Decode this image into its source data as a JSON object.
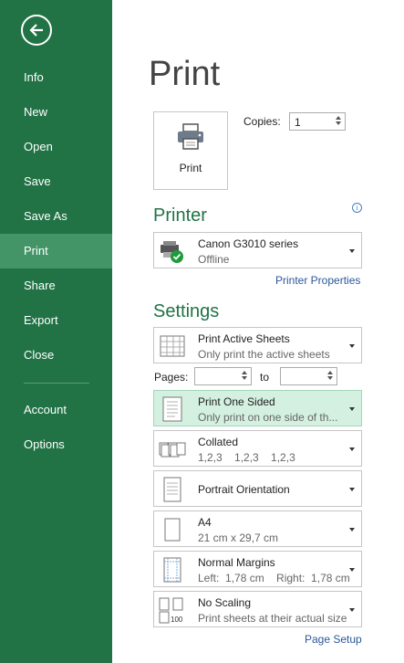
{
  "sidebar": {
    "items": [
      {
        "label": "Info"
      },
      {
        "label": "New"
      },
      {
        "label": "Open"
      },
      {
        "label": "Save"
      },
      {
        "label": "Save As"
      },
      {
        "label": "Print",
        "active": true
      },
      {
        "label": "Share"
      },
      {
        "label": "Export"
      },
      {
        "label": "Close"
      }
    ],
    "bottom_items": [
      {
        "label": "Account"
      },
      {
        "label": "Options"
      }
    ],
    "back_icon": "back-arrow-icon"
  },
  "main": {
    "title": "Print",
    "print_button": {
      "label": "Print",
      "icon": "printer-icon"
    },
    "copies": {
      "label": "Copies:",
      "value": "1"
    },
    "printer_section": "Printer",
    "printer": {
      "name": "Canon G3010 series",
      "status": "Offline"
    },
    "printer_properties_link": "Printer Properties",
    "settings_section": "Settings",
    "pages": {
      "label": "Pages:",
      "to_label": "to",
      "from": "",
      "to": ""
    },
    "settings": [
      {
        "line1": "Print Active Sheets",
        "line2": "Only print the active sheets",
        "icon": "sheets-icon"
      },
      {
        "line1": "Print One Sided",
        "line2": "Only print on one side of th...",
        "icon": "one-sided-icon",
        "highlighted": true
      },
      {
        "line1": "Collated",
        "line2": "1,2,3    1,2,3    1,2,3",
        "icon": "collated-icon"
      },
      {
        "line1": "Portrait Orientation",
        "line2": "",
        "icon": "portrait-icon"
      },
      {
        "line1": "A4",
        "line2": "21 cm x 29,7 cm",
        "icon": "paper-size-icon"
      },
      {
        "line1": "Normal Margins",
        "line2": "Left:  1,78 cm    Right:  1,78 cm",
        "icon": "margins-icon"
      },
      {
        "line1": "No Scaling",
        "line2": "Print sheets at their actual size",
        "icon": "scaling-icon"
      }
    ],
    "page_setup_link": "Page Setup"
  },
  "colors": {
    "accent": "#217346",
    "active_nav": "#439467",
    "highlight": "#d3f0e0",
    "link": "#2b579a"
  }
}
